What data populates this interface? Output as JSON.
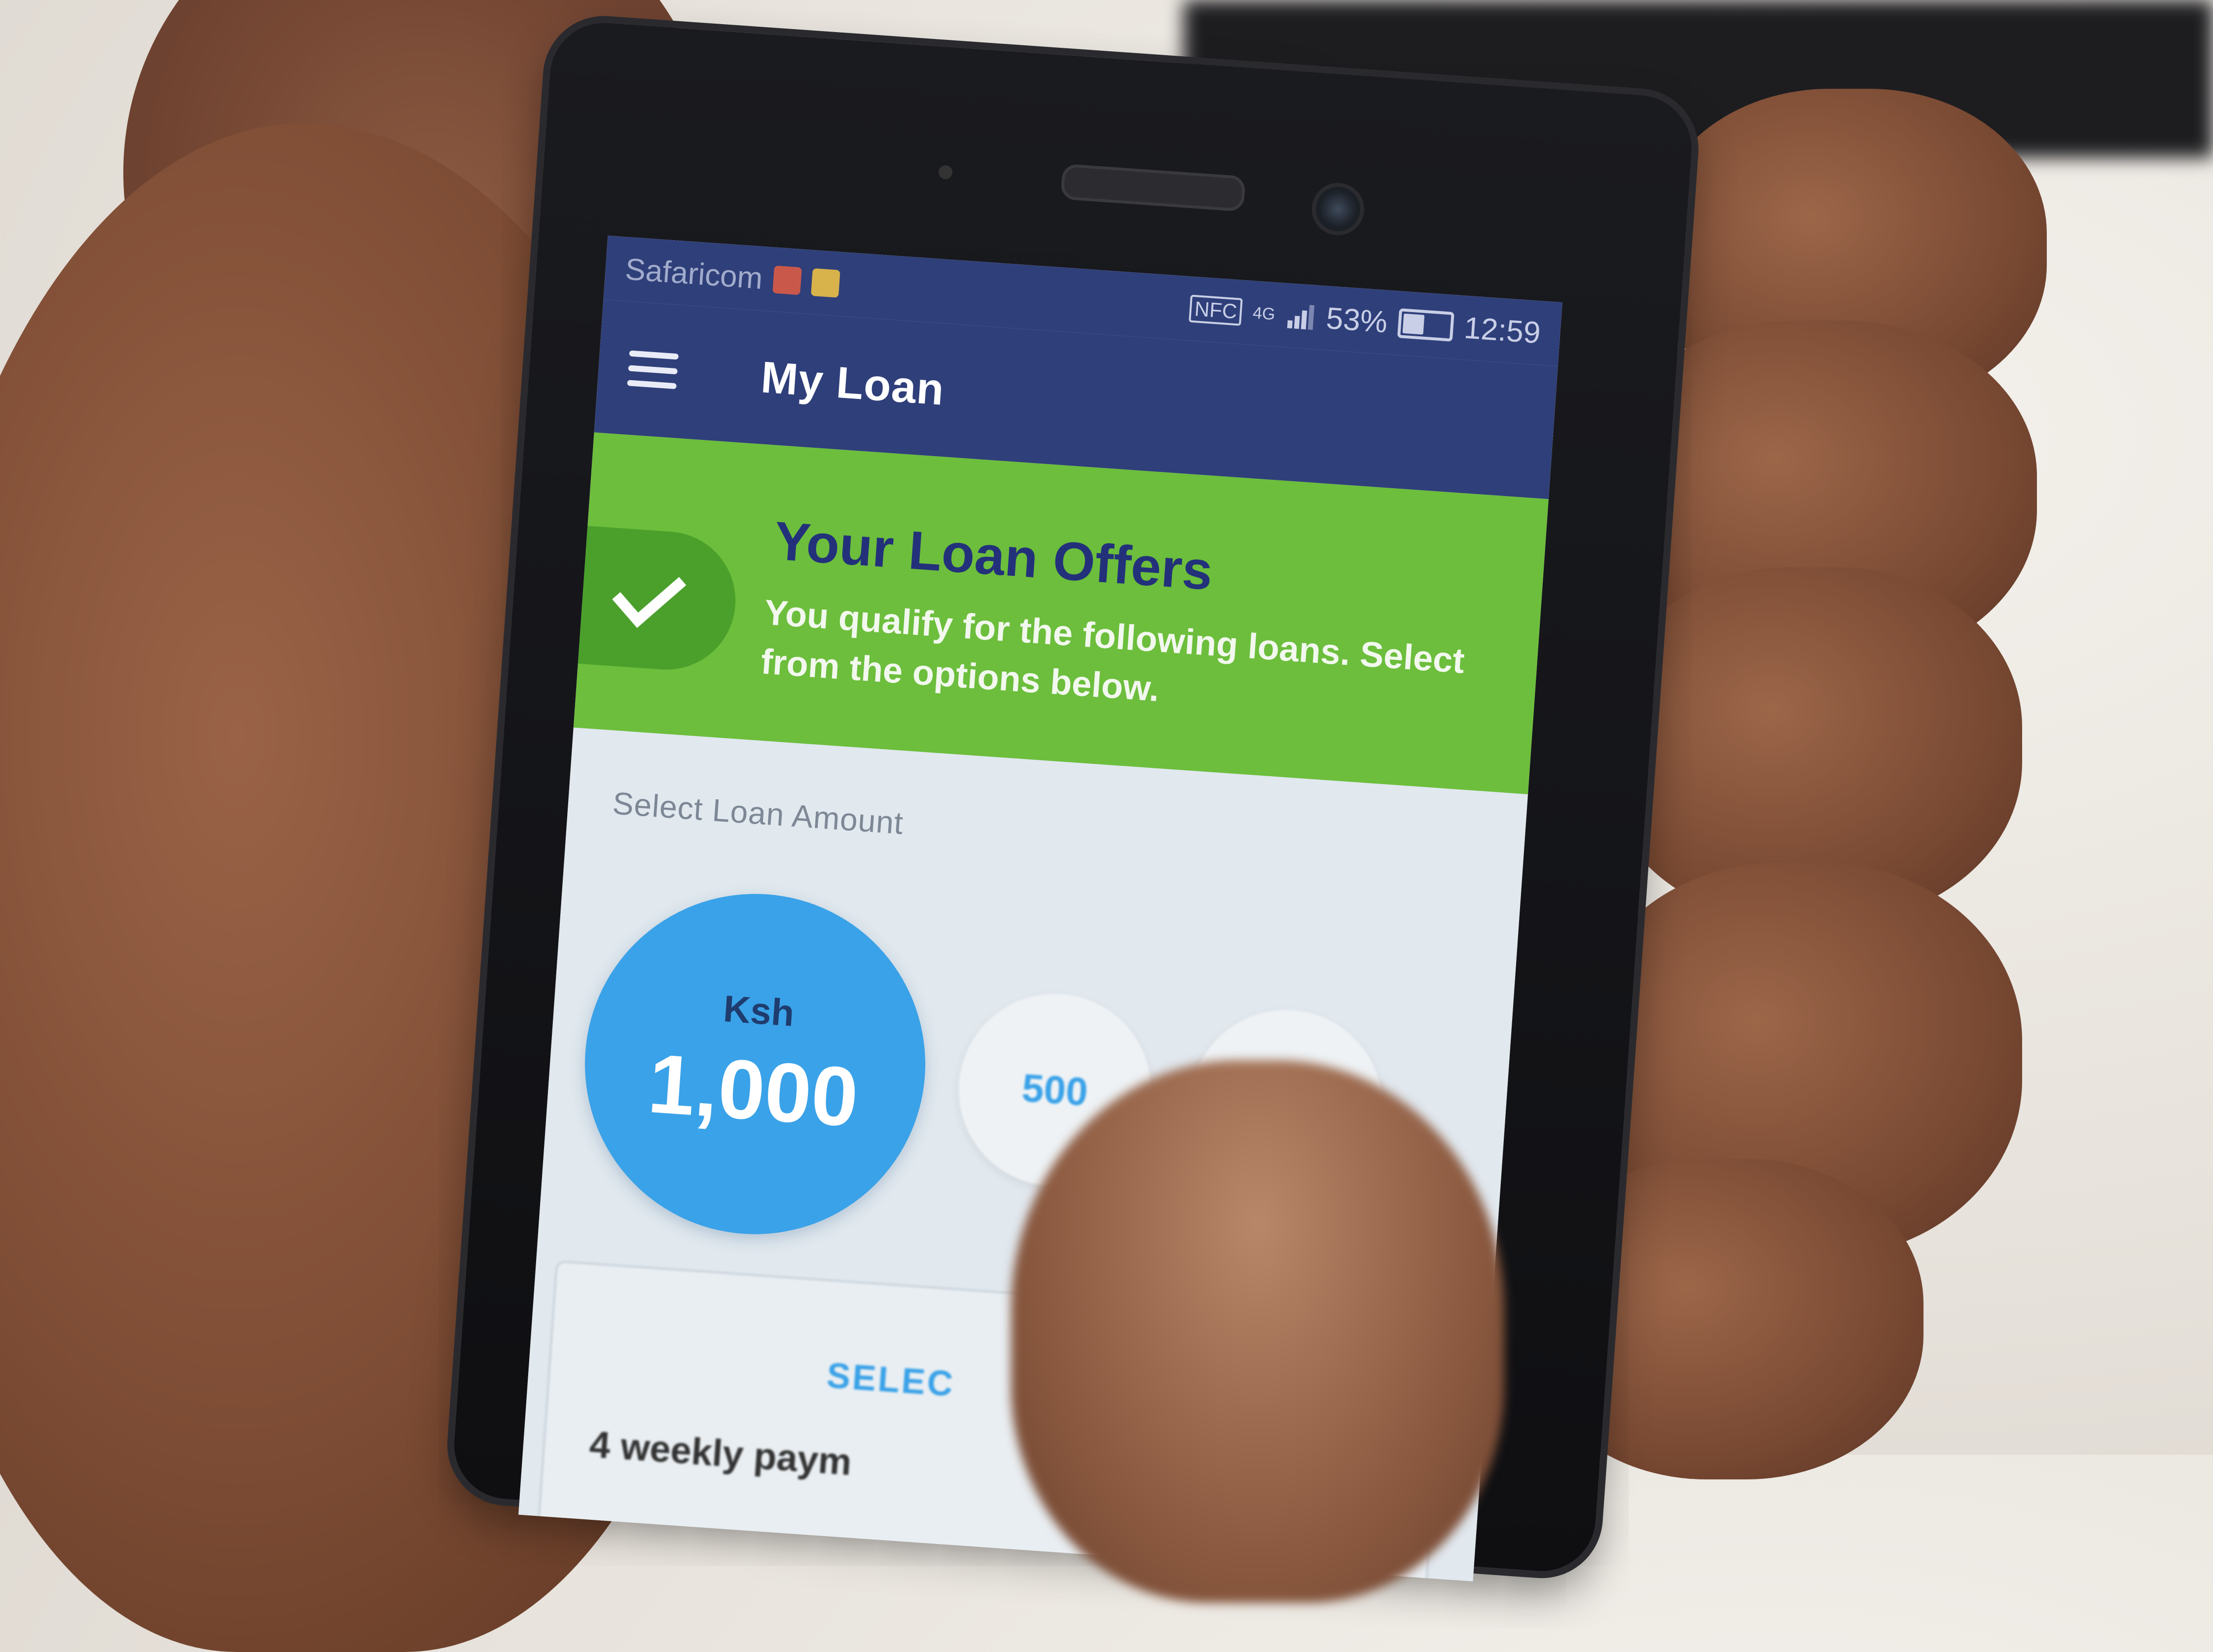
{
  "status_bar": {
    "carrier": "Safaricom",
    "nfc": "NFC",
    "network": "4G",
    "battery_percent": "53%",
    "battery_level": 0.53,
    "time": "12:59"
  },
  "app_bar": {
    "menu_icon": "hamburger-menu-icon",
    "title": "My Loan"
  },
  "banner": {
    "icon": "checkmark-icon",
    "title": "Your Loan Offers",
    "subtitle": "You qualify for the following loans. Select from the options below."
  },
  "loan_selector": {
    "label": "Select Loan Amount",
    "selected": {
      "currency": "Ksh",
      "amount": "1,000"
    },
    "options": [
      "500",
      ""
    ]
  },
  "loan_card": {
    "action": "SELEC",
    "description": "4 weekly paym"
  },
  "colors": {
    "app_bar": "#2f3f7a",
    "banner": "#6cbe3c",
    "selected_amount": "#3aa2e8",
    "banner_title": "#23317a"
  }
}
